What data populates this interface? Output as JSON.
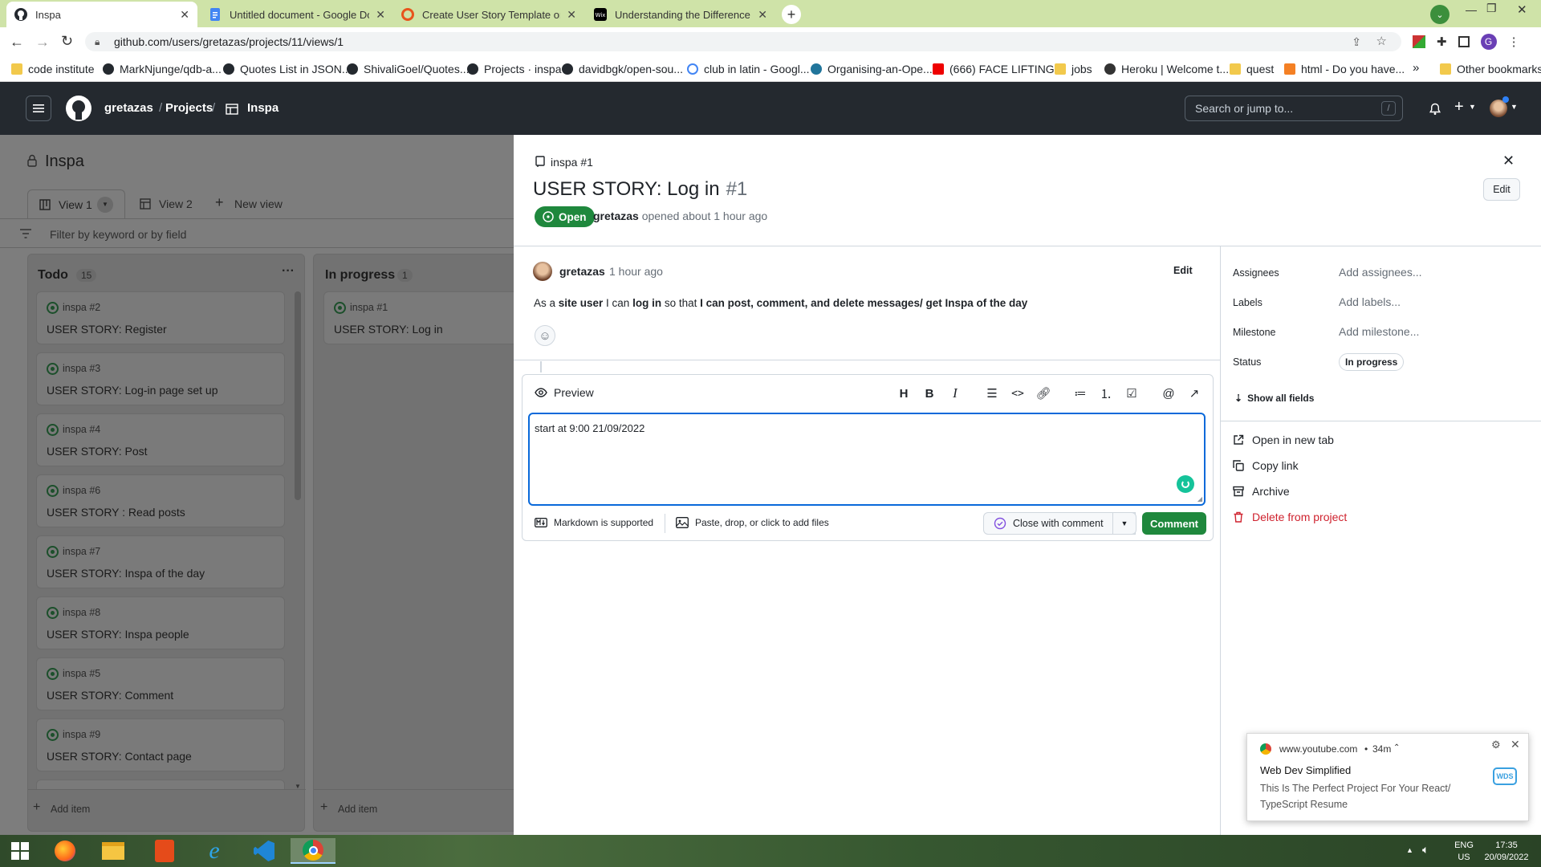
{
  "browser": {
    "tabs": [
      {
        "title": "Inspa",
        "active": true,
        "favicon": "github-icon"
      },
      {
        "title": "Untitled document - Google Doc",
        "active": false,
        "favicon": "google-docs-icon"
      },
      {
        "title": "Create User Story Template on G",
        "active": false,
        "favicon": "opera-icon"
      },
      {
        "title": "Understanding the Difference Be",
        "active": false,
        "favicon": "wix-icon"
      }
    ],
    "url": "github.com/users/gretazas/projects/11/views/1",
    "bookmarks": [
      "code institute",
      "MarkNjunge/qdb-a...",
      "Quotes List in JSON...",
      "ShivaliGoel/Quotes...",
      "Projects · inspa",
      "davidbgk/open-sou...",
      "club in latin - Googl...",
      "Organising-an-Ope...",
      "(666) FACE LIFTING...",
      "jobs",
      "Heroku | Welcome t...",
      "quest",
      "html - Do you have..."
    ],
    "other_bookmarks": "Other bookmarks",
    "profile_initial": "G",
    "overflow": "»"
  },
  "gh_header": {
    "breadcrumb": [
      "gretazas",
      "Projects",
      "Inspa"
    ],
    "separator": "/",
    "search_placeholder": "Search or jump to...",
    "search_key": "/"
  },
  "project": {
    "title": "Inspa",
    "views": [
      "View 1",
      "View 2"
    ],
    "new_view": "New view",
    "filter_placeholder": "Filter by keyword or by field",
    "columns": [
      {
        "name": "Todo",
        "count": "15",
        "menu": "···",
        "cards": [
          {
            "num": "inspa #2",
            "title": "USER STORY: Register"
          },
          {
            "num": "inspa #3",
            "title": "USER STORY: Log-in page set up"
          },
          {
            "num": "inspa #4",
            "title": "USER STORY: Post"
          },
          {
            "num": "inspa #6",
            "title": "USER STORY : Read posts"
          },
          {
            "num": "inspa #7",
            "title": "USER STORY: Inspa of the day"
          },
          {
            "num": "inspa #8",
            "title": "USER STORY: Inspa people"
          },
          {
            "num": "inspa #5",
            "title": "USER STORY: Comment"
          },
          {
            "num": "inspa #9",
            "title": "USER STORY: Contact page"
          }
        ],
        "add_item": "Add item"
      },
      {
        "name": "In progress",
        "count": "1",
        "cards": [
          {
            "num": "inspa #1",
            "title": "USER STORY: Log in"
          }
        ],
        "add_item": "Add item"
      }
    ]
  },
  "issue": {
    "repo_ref": "inspa #1",
    "title": "USER STORY: Log in",
    "number": "#1",
    "edit_label": "Edit",
    "state": "Open",
    "author": "gretazas",
    "opened_text": "opened about 1 hour ago",
    "comment_author": "gretazas",
    "comment_time": "1 hour ago",
    "comment_edit": "Edit",
    "body": {
      "p1": "As a ",
      "b1": "site user",
      "p2": " I can ",
      "b2": "log in",
      "p3": " so that ",
      "b3": "I can post, comment, and delete messages/ get Inspa of the day"
    }
  },
  "editor": {
    "preview_label": "Preview",
    "text_value": "start at 9:00 21/09/2022",
    "markdown_note": "Markdown is supported",
    "attach_note": "Paste, drop, or click to add files",
    "close_with_comment": "Close with comment",
    "comment_button": "Comment",
    "accent": "#1f883d"
  },
  "fields": {
    "assignees_label": "Assignees",
    "assignees_value": "Add assignees...",
    "labels_label": "Labels",
    "labels_value": "Add labels...",
    "milestone_label": "Milestone",
    "milestone_value": "Add milestone...",
    "status_label": "Status",
    "status_value": "In progress",
    "show_all": "Show all fields"
  },
  "actions": {
    "open_tab": "Open in new tab",
    "copy_link": "Copy link",
    "archive": "Archive",
    "delete": "Delete from project"
  },
  "notification": {
    "source": "www.youtube.com",
    "age": "34m",
    "channel": "Web Dev Simplified",
    "message": "This Is The Perfect Project For Your React/ TypeScript Resume",
    "logo_text": "WDS"
  },
  "taskbar": {
    "lang": "ENG",
    "region": "US",
    "time": "17:35",
    "date": "20/09/2022"
  }
}
